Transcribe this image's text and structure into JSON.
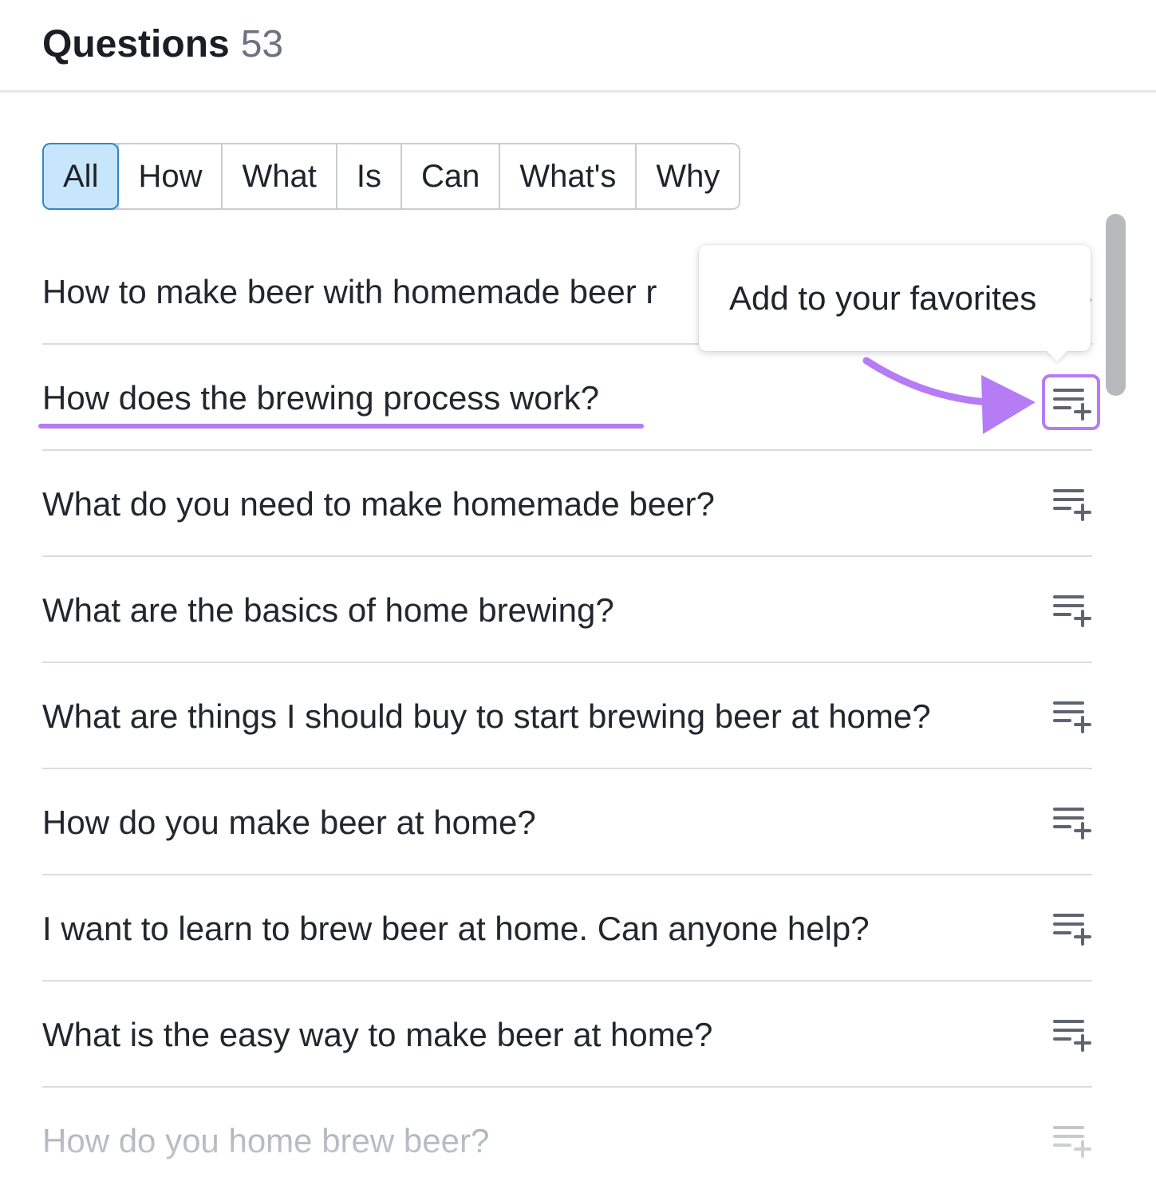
{
  "header": {
    "title": "Questions",
    "count": "53"
  },
  "filters": [
    {
      "label": "All",
      "active": true
    },
    {
      "label": "How",
      "active": false
    },
    {
      "label": "What",
      "active": false
    },
    {
      "label": "Is",
      "active": false
    },
    {
      "label": "Can",
      "active": false
    },
    {
      "label": "What's",
      "active": false
    },
    {
      "label": "Why",
      "active": false
    }
  ],
  "questions": [
    "How to make beer with homemade beer r",
    "How does the brewing process work?",
    "What do you need to make homemade beer?",
    "What are the basics of home brewing?",
    "What are things I should buy to start brewing beer at home?",
    "How do you make beer at home?",
    "I want to learn to brew beer at home. Can anyone help?",
    "What is the easy way to make beer at home?",
    "How do you home brew beer?"
  ],
  "tooltip": {
    "text": "Add to your favorites"
  },
  "icons": {
    "add_to_list": "playlist-add-icon"
  },
  "colors": {
    "highlight": "#b57cf5",
    "active_filter_bg": "#c8e6fb",
    "active_filter_border": "#2f87c8",
    "icon": "#5f6470"
  }
}
